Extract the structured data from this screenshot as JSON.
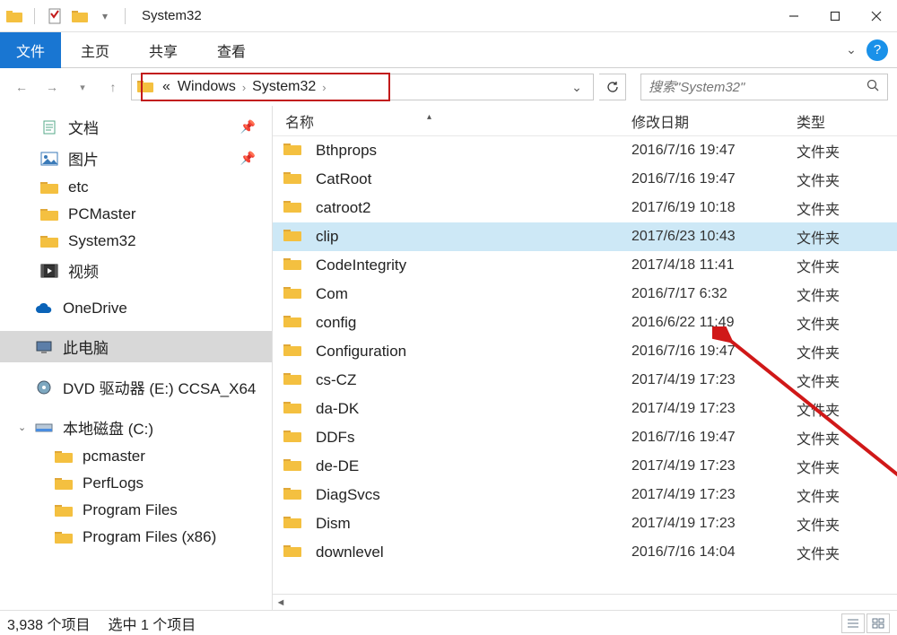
{
  "window": {
    "title": "System32"
  },
  "ribbon": {
    "file": "文件",
    "tabs": [
      "主页",
      "共享",
      "查看"
    ]
  },
  "breadcrumb": {
    "overflow": "«",
    "parts": [
      "Windows",
      "System32"
    ]
  },
  "search": {
    "placeholder": "搜索\"System32\""
  },
  "sidebar": {
    "quick": [
      {
        "icon": "doc",
        "label": "文档",
        "pinned": true
      },
      {
        "icon": "pic",
        "label": "图片",
        "pinned": true
      },
      {
        "icon": "folder",
        "label": "etc"
      },
      {
        "icon": "folder",
        "label": "PCMaster"
      },
      {
        "icon": "folder",
        "label": "System32"
      },
      {
        "icon": "video",
        "label": "视频"
      }
    ],
    "onedrive": "OneDrive",
    "thispc": "此电脑",
    "dvd": "DVD 驱动器 (E:) CCSA_X64",
    "localdisk": "本地磁盘 (C:)",
    "localsub": [
      "pcmaster",
      "PerfLogs",
      "Program Files",
      "Program Files (x86)"
    ]
  },
  "columns": {
    "name": "名称",
    "date": "修改日期",
    "type": "类型"
  },
  "files": [
    {
      "name": "Bthprops",
      "date": "2016/7/16 19:47",
      "type": "文件夹"
    },
    {
      "name": "CatRoot",
      "date": "2016/7/16 19:47",
      "type": "文件夹"
    },
    {
      "name": "catroot2",
      "date": "2017/6/19 10:18",
      "type": "文件夹"
    },
    {
      "name": "clip",
      "date": "2017/6/23 10:43",
      "type": "文件夹",
      "selected": true
    },
    {
      "name": "CodeIntegrity",
      "date": "2017/4/18 11:41",
      "type": "文件夹"
    },
    {
      "name": "Com",
      "date": "2016/7/17 6:32",
      "type": "文件夹"
    },
    {
      "name": "config",
      "date": "2016/6/22 11:49",
      "type": "文件夹"
    },
    {
      "name": "Configuration",
      "date": "2016/7/16 19:47",
      "type": "文件夹"
    },
    {
      "name": "cs-CZ",
      "date": "2017/4/19 17:23",
      "type": "文件夹"
    },
    {
      "name": "da-DK",
      "date": "2017/4/19 17:23",
      "type": "文件夹"
    },
    {
      "name": "DDFs",
      "date": "2016/7/16 19:47",
      "type": "文件夹"
    },
    {
      "name": "de-DE",
      "date": "2017/4/19 17:23",
      "type": "文件夹"
    },
    {
      "name": "DiagSvcs",
      "date": "2017/4/19 17:23",
      "type": "文件夹"
    },
    {
      "name": "Dism",
      "date": "2017/4/19 17:23",
      "type": "文件夹"
    },
    {
      "name": "downlevel",
      "date": "2016/7/16 14:04",
      "type": "文件夹"
    }
  ],
  "status": {
    "items": "3,938 个项目",
    "selected": "选中 1 个项目"
  }
}
